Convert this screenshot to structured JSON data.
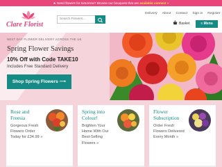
{
  "announcement": {
    "lead": "★ Need flowers for tomorrow? Browse our bouquets that are",
    "highlight": "available connect »"
  },
  "header": {
    "logo_text": "Clare Florist",
    "search_placeholder": "Search Flowers...",
    "nav": [
      "Delivery",
      "About",
      "Contact",
      "Sign in",
      "Register"
    ],
    "basket_label": "Basket",
    "menu_label": "≡ Menu"
  },
  "hero": {
    "eyebrow": "NEXT DAY FLOWER DELIVERY ACROSS THE UK",
    "title": "Spring Flower Savings",
    "offer": "10% Off with Code TAKE10",
    "subtitle": "Includes Free Standard Delivery",
    "cta": "Shop Spring Flowers ⟶"
  },
  "promos": [
    {
      "title": "Rose and Freesia",
      "text": "Gorgeous Fresh Flowers Order Today for £34.99 »"
    },
    {
      "title": "Spring into Colour!",
      "text": "Brighten Your Home With Our Best-Selling Flowers »"
    },
    {
      "title": "Flower Subscription",
      "text": "Order Fresh Flowers Delivered Every Month »"
    }
  ],
  "colors": {
    "brand_pink": "#e8457a",
    "teal": "#168a84",
    "hero_bg": "#f6d4dc"
  },
  "icons": [
    "flower-logo-icon",
    "search-icon",
    "basket-icon",
    "menu-icon"
  ]
}
